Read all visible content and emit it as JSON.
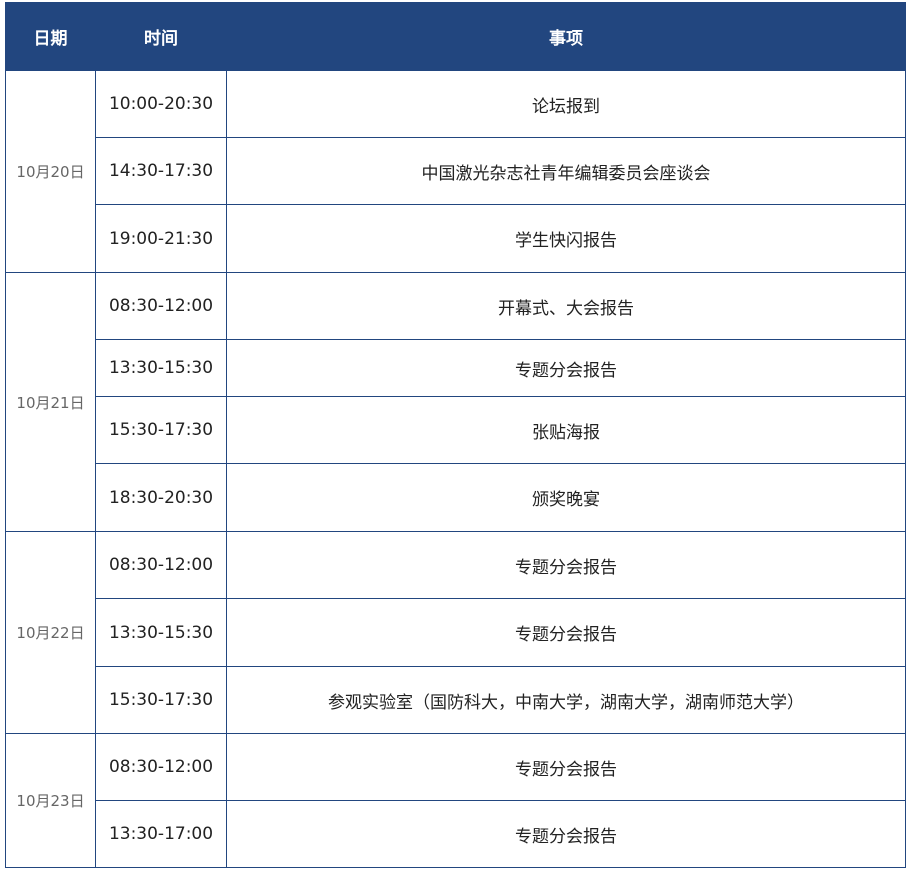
{
  "headers": {
    "date": "日期",
    "time": "时间",
    "item": "事项"
  },
  "groups": [
    {
      "date": "10月20日",
      "rows": [
        {
          "time": "10:00-20:30",
          "item": "论坛报到"
        },
        {
          "time": "14:30-17:30",
          "item": "中国激光杂志社青年编辑委员会座谈会"
        },
        {
          "time": "19:00-21:30",
          "item": "学生快闪报告"
        }
      ]
    },
    {
      "date": "10月21日",
      "rows": [
        {
          "time": "08:30-12:00",
          "item": "开幕式、大会报告"
        },
        {
          "time": "13:30-15:30",
          "item": "专题分会报告"
        },
        {
          "time": "15:30-17:30",
          "item": "张贴海报"
        },
        {
          "time": "18:30-20:30",
          "item": "颁奖晚宴"
        }
      ]
    },
    {
      "date": "10月22日",
      "rows": [
        {
          "time": "08:30-12:00",
          "item": "专题分会报告"
        },
        {
          "time": "13:30-15:30",
          "item": "专题分会报告"
        },
        {
          "time": "15:30-17:30",
          "item": "参观实验室（国防科大，中南大学，湖南大学，湖南师范大学）"
        }
      ]
    },
    {
      "date": "10月23日",
      "rows": [
        {
          "time": "08:30-12:00",
          "item": "专题分会报告"
        },
        {
          "time": "13:30-17:00",
          "item": "专题分会报告"
        }
      ]
    }
  ]
}
